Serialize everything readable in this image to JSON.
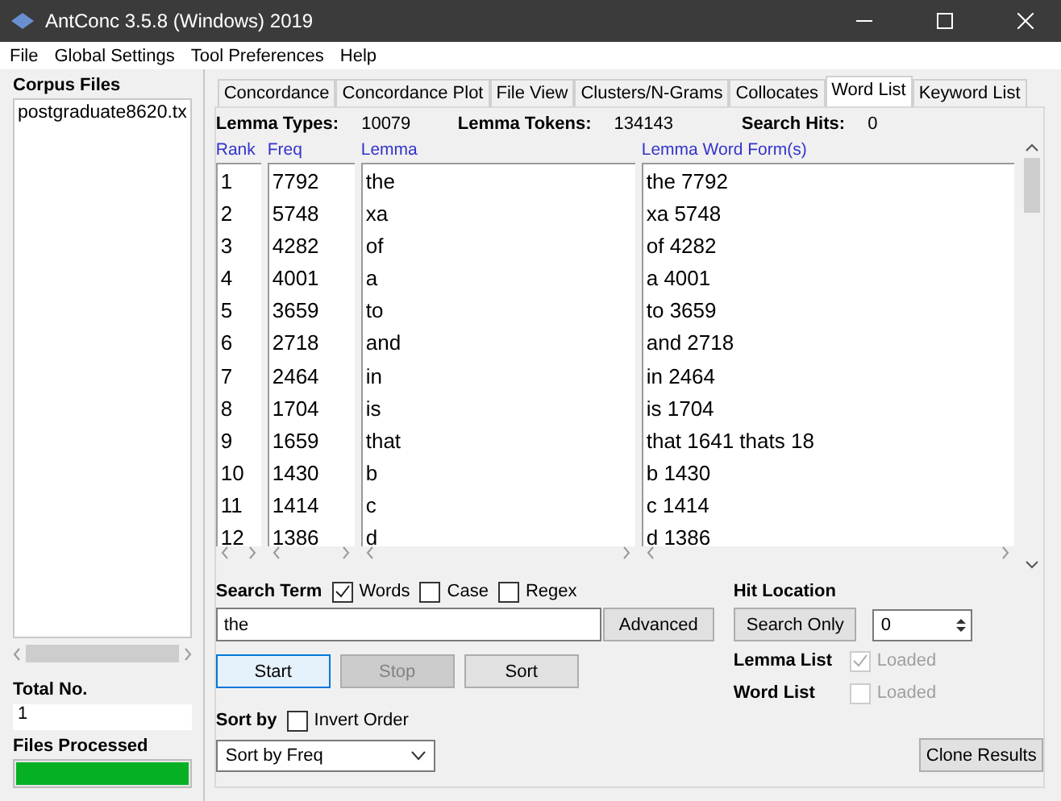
{
  "window": {
    "title": "AntConc 3.5.8 (Windows) 2019"
  },
  "menu": [
    "File",
    "Global Settings",
    "Tool Preferences",
    "Help"
  ],
  "sidebar": {
    "heading": "Corpus Files",
    "files": [
      {
        "name": "postgraduate8620.tx",
        "selected": false
      }
    ],
    "total_label": "Total No.",
    "total": "1",
    "processed_label": "Files Processed",
    "level": 1
  },
  "tabs": [
    {
      "label": "Concordance",
      "selected": false
    },
    {
      "label": "Concordance Plot",
      "selected": false
    },
    {
      "label": "File View",
      "selected": false
    },
    {
      "label": "Clusters/N-Grams",
      "selected": false
    },
    {
      "label": "Collocates",
      "selected": false
    },
    {
      "label": "Word List",
      "selected": true
    },
    {
      "label": "Keyword List",
      "selected": false
    }
  ],
  "stats": [
    {
      "label": "Lemma Types:",
      "value": "10079"
    },
    {
      "label": "Lemma Tokens:",
      "value": "134143"
    },
    {
      "label": "Search Hits:",
      "value": "0"
    }
  ],
  "table": {
    "columns": [
      "Rank",
      "Freq",
      "Lemma",
      "Lemma Word Form(s)"
    ],
    "rows": [
      [
        "1",
        "7792",
        "the",
        "the 7792"
      ],
      [
        "2",
        "5748",
        "xa",
        "xa 5748"
      ],
      [
        "3",
        "4282",
        "of",
        "of 4282"
      ],
      [
        "4",
        "4001",
        "a",
        "a 4001"
      ],
      [
        "5",
        "3659",
        "to",
        "to 3659"
      ],
      [
        "6",
        "2718",
        "and",
        "and 2718"
      ],
      [
        "7",
        "2464",
        "in",
        "in 2464"
      ],
      [
        "8",
        "1704",
        "is",
        "is 1704"
      ],
      [
        "9",
        "1659",
        "that",
        "that 1641 thats 18"
      ],
      [
        "10",
        "1430",
        "b",
        "b 1430"
      ],
      [
        "11",
        "1414",
        "c",
        "c 1414"
      ],
      [
        "12",
        "1386",
        "d",
        "d 1386"
      ]
    ]
  },
  "search": {
    "label": "Search Term",
    "options": [
      {
        "label": "Words",
        "checked": true
      },
      {
        "label": "Case",
        "checked": false
      },
      {
        "label": "Regex",
        "checked": false
      }
    ],
    "value": "the",
    "advanced": "Advanced"
  },
  "actions": [
    {
      "label": "Start",
      "disabled": false,
      "focused": true
    },
    {
      "label": "Stop",
      "disabled": true,
      "focused": false
    },
    {
      "label": "Sort",
      "disabled": false,
      "focused": false
    }
  ],
  "sort": {
    "label": "Sort by",
    "invert": {
      "label": "Invert Order",
      "checked": false
    },
    "value": "Sort by Freq"
  },
  "hit": {
    "label": "Hit Location",
    "button": "Search Only",
    "value": "0"
  },
  "lists": [
    {
      "label": "Lemma List",
      "option": "Loaded",
      "checked": true
    },
    {
      "label": "Word List",
      "option": "Loaded",
      "checked": false
    }
  ],
  "clone": "Clone Results"
}
